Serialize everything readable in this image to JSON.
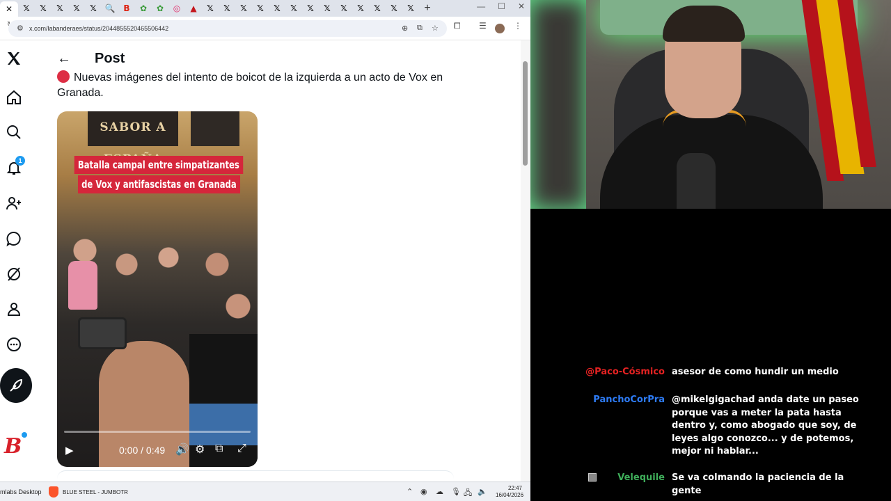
{
  "browser": {
    "tabs": [
      {
        "icon": "close-icon",
        "glyph": "✕",
        "active": true
      },
      {
        "icon": "x-logo-icon",
        "glyph": "𝕏"
      },
      {
        "icon": "x-logo-icon",
        "glyph": "𝕏"
      },
      {
        "icon": "x-logo-icon",
        "glyph": "𝕏"
      },
      {
        "icon": "x-logo-icon",
        "glyph": "𝕏"
      },
      {
        "icon": "x-logo-icon",
        "glyph": "𝕏"
      },
      {
        "icon": "search-icon",
        "glyph": "🔍"
      },
      {
        "icon": "bluesky-b-icon",
        "glyph": "B"
      },
      {
        "icon": "leaf-icon",
        "glyph": "✿"
      },
      {
        "icon": "leaf-icon",
        "glyph": "✿"
      },
      {
        "icon": "instagram-icon",
        "glyph": "◎"
      },
      {
        "icon": "pdf-icon",
        "glyph": "▲"
      },
      {
        "icon": "x-logo-icon",
        "glyph": "𝕏"
      },
      {
        "icon": "x-logo-icon",
        "glyph": "𝕏"
      },
      {
        "icon": "x-logo-icon",
        "glyph": "𝕏"
      },
      {
        "icon": "x-logo-icon",
        "glyph": "𝕏"
      },
      {
        "icon": "x-logo-icon",
        "glyph": "𝕏"
      },
      {
        "icon": "x-logo-icon",
        "glyph": "𝕏"
      },
      {
        "icon": "x-logo-icon",
        "glyph": "𝕏"
      },
      {
        "icon": "x-logo-icon",
        "glyph": "𝕏"
      },
      {
        "icon": "x-logo-icon",
        "glyph": "𝕏"
      },
      {
        "icon": "x-logo-icon",
        "glyph": "𝕏"
      },
      {
        "icon": "x-logo-icon",
        "glyph": "𝕏"
      },
      {
        "icon": "x-logo-icon",
        "glyph": "𝕏"
      },
      {
        "icon": "x-logo-icon",
        "glyph": "𝕏"
      }
    ],
    "new_tab": "+",
    "url": "x.com/labanderaes/status/2044855520465506442"
  },
  "x_sidebar": {
    "notifications_count": "1"
  },
  "post": {
    "back": "←",
    "title": "Post",
    "text": "Nuevas imágenes del intento de boicot de la izquierda a un acto de Vox en Granada.",
    "video": {
      "sign": "SABOR A ESPAÑA",
      "headline_line1": "Batalla campal entre simpatizantes",
      "headline_line2": "de Vox y antifascistas en Granada",
      "time": "0:00 / 0:49",
      "progress": 0
    }
  },
  "taskbar": {
    "app1": "mlabs Desktop",
    "app2": "BLUE STEEL - JUMBOTR",
    "time": "22:47",
    "date": "16/04/2026"
  },
  "chat": [
    {
      "user": "@Paco-Cósmico",
      "color": "#e52222",
      "message": "asesor de como hundir un medio"
    },
    {
      "user": "PanchoCorPra",
      "color": "#2e7cf6",
      "message": "@mikelgigachad anda date un paseo porque vas a meter la pata hasta dentro y, como abogado que soy, de leyes algo conozco... y de potemos, mejor ni hablar..."
    },
    {
      "user": "Velequile",
      "color": "#3fae5a",
      "message": "Se va colmando la paciencia de la gente"
    }
  ]
}
